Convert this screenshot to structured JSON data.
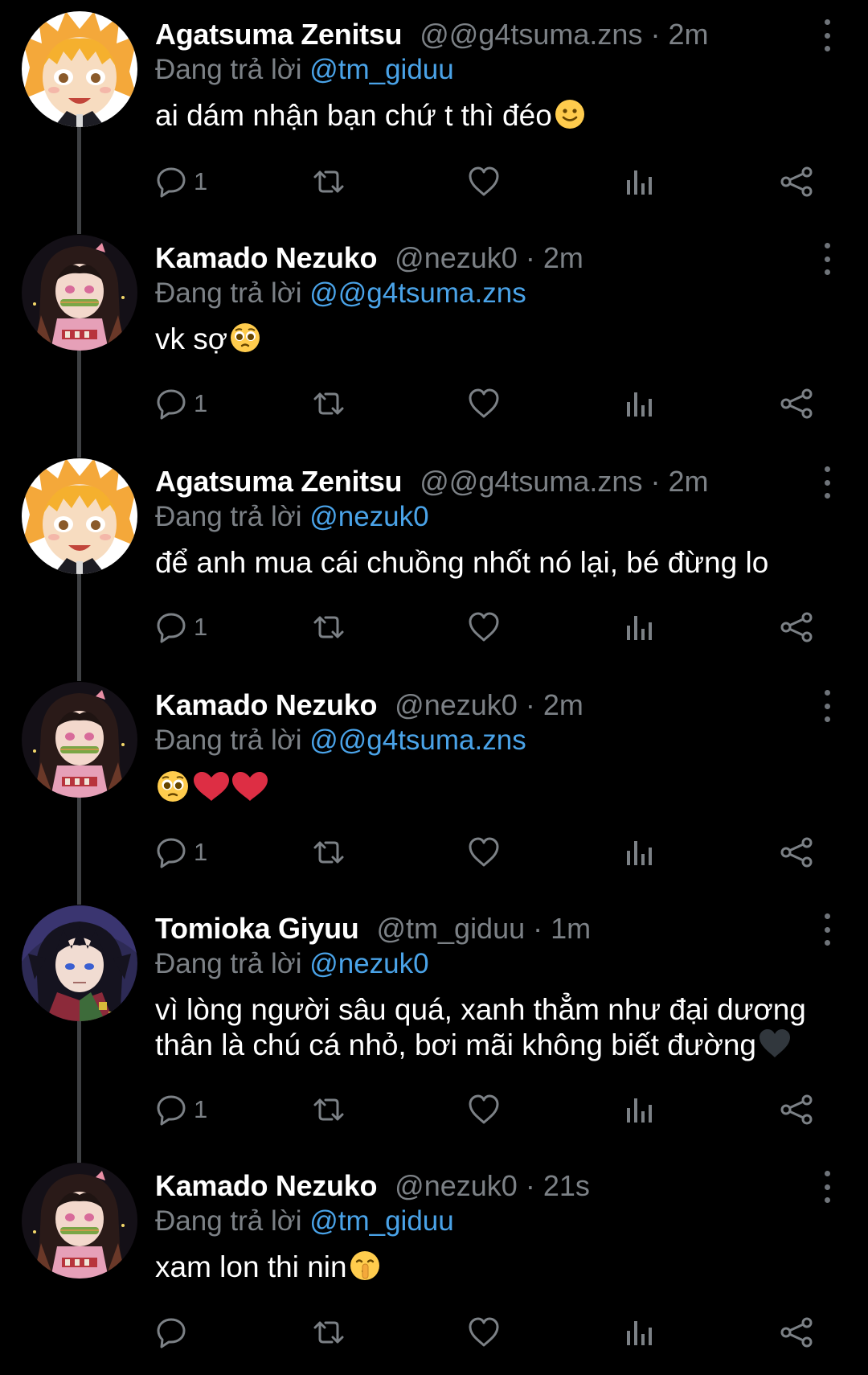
{
  "reply_prefix": "Đang trả lời",
  "colors": {
    "background": "#000000",
    "mention": "#4aa3e8",
    "secondary_text": "#7c8186",
    "thread_line": "#3f4144"
  },
  "tweets": [
    {
      "name": "Agatsuma Zenitsu",
      "handle": "@@g4tsuma.zns",
      "separator": "·",
      "time": "2m",
      "replying_to": "@tm_giduu",
      "text_lines": [
        "ai dám nhận bạn chứ t thì đéo"
      ],
      "trailing_emoji": "slightly-smiling-face-emoji",
      "reply_count": "1"
    },
    {
      "name": "Kamado Nezuko",
      "handle": "@nezuk0",
      "separator": "·",
      "time": "2m",
      "replying_to": "@@g4tsuma.zns",
      "text_lines": [
        "vk sợ"
      ],
      "trailing_emoji": "pleading-face-emoji",
      "reply_count": "1"
    },
    {
      "name": "Agatsuma Zenitsu",
      "handle": "@@g4tsuma.zns",
      "separator": "·",
      "time": "2m",
      "replying_to": "@nezuk0",
      "text_lines": [
        "để anh mua cái chuồng nhốt nó lại, bé đừng lo"
      ],
      "trailing_emoji": "",
      "reply_count": "1"
    },
    {
      "name": "Kamado Nezuko",
      "handle": "@nezuk0",
      "separator": "·",
      "time": "2m",
      "replying_to": "@@g4tsuma.zns",
      "text_lines": [
        ""
      ],
      "trailing_emoji": "pleading-face-and-two-red-hearts-emoji",
      "reply_count": "1"
    },
    {
      "name": "Tomioka Giyuu",
      "handle": "@tm_giduu",
      "separator": "·",
      "time": "1m",
      "replying_to": "@nezuk0",
      "text_lines": [
        "vì lòng người sâu quá, xanh thẳm như đại dương",
        "thân là chú cá nhỏ, bơi mãi không biết đường"
      ],
      "trailing_emoji": "black-heart-emoji",
      "reply_count": "1"
    },
    {
      "name": "Kamado Nezuko",
      "handle": "@nezuk0",
      "separator": "·",
      "time": "21s",
      "replying_to": "@tm_giduu",
      "text_lines": [
        "xam lon thi nin"
      ],
      "trailing_emoji": "shushing-face-emoji",
      "reply_count": ""
    }
  ]
}
